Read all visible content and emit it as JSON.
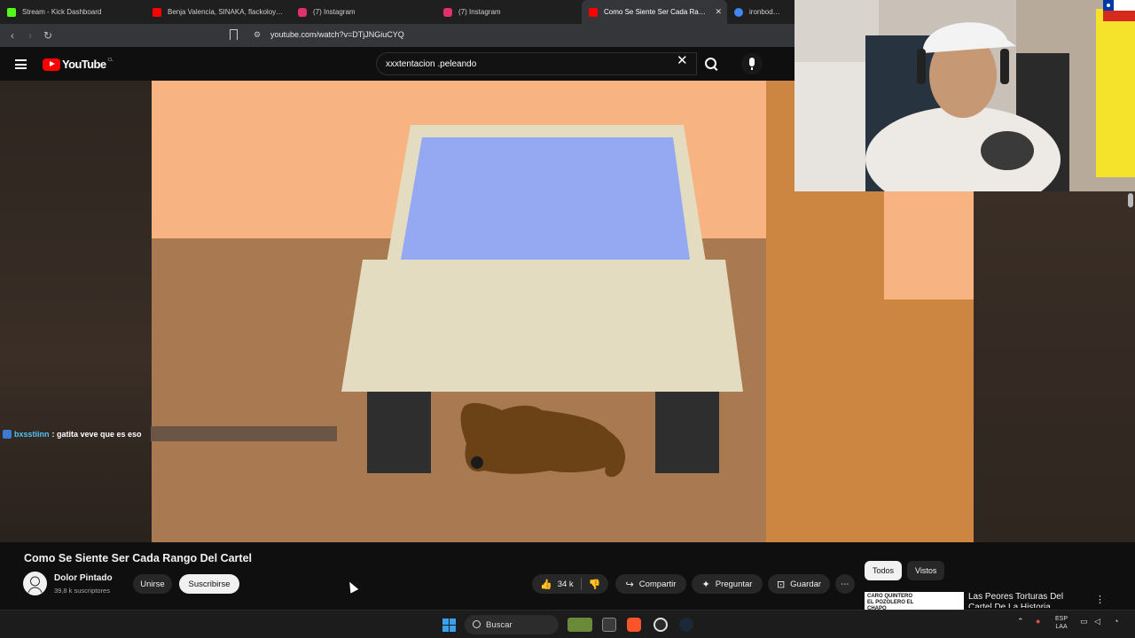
{
  "browser": {
    "tabs": [
      {
        "title": "Stream - Kick Dashboard",
        "icon": "kick-icon",
        "color": "#53fc18",
        "active": false
      },
      {
        "title": "Benja Valencia, SINAKA, flackoloyal -",
        "icon": "youtube-icon",
        "color": "#ff0000",
        "active": false
      },
      {
        "title": "(7) Instagram",
        "icon": "instagram-icon",
        "color": "#e1306c",
        "active": false
      },
      {
        "title": "(7) Instagram",
        "icon": "instagram-icon",
        "color": "#e1306c",
        "active": false
      },
      {
        "title": "Como Se Siente Ser Cada Rango",
        "icon": "youtube-icon",
        "color": "#ff0000",
        "active": true
      },
      {
        "title": "ironbodrio - B",
        "icon": "google-icon",
        "color": "#4285f4",
        "active": false
      }
    ],
    "url": "youtube.com/watch?v=DTjJNGiuCYQ"
  },
  "youtube": {
    "logo_text": "YouTube",
    "region": "CL",
    "search_value": "xxxtentacion .peleando"
  },
  "chat": {
    "user": "bxsstiinn",
    "message": ": gatita veve que es eso"
  },
  "video": {
    "title": "Como Se Siente Ser Cada Rango Del Cartel",
    "channel": "Dolor Pintado",
    "subscribers": "39,8 k suscriptores",
    "join_label": "Unirse",
    "subscribe_label": "Suscribirse",
    "likes": "34 k",
    "share_label": "Compartir",
    "ask_label": "Preguntar",
    "save_label": "Guardar"
  },
  "sidebar": {
    "chips": [
      "Todos",
      "Vistos"
    ],
    "recommendation": {
      "title": "Las Peores Torturas Del Cartel De La Historia",
      "thumb_text": "CARO QUINTERO EL POZOLERO EL CHAPO"
    }
  },
  "taskbar": {
    "search_label": "Buscar",
    "lang_top": "ESP",
    "lang_bottom": "LAA"
  }
}
